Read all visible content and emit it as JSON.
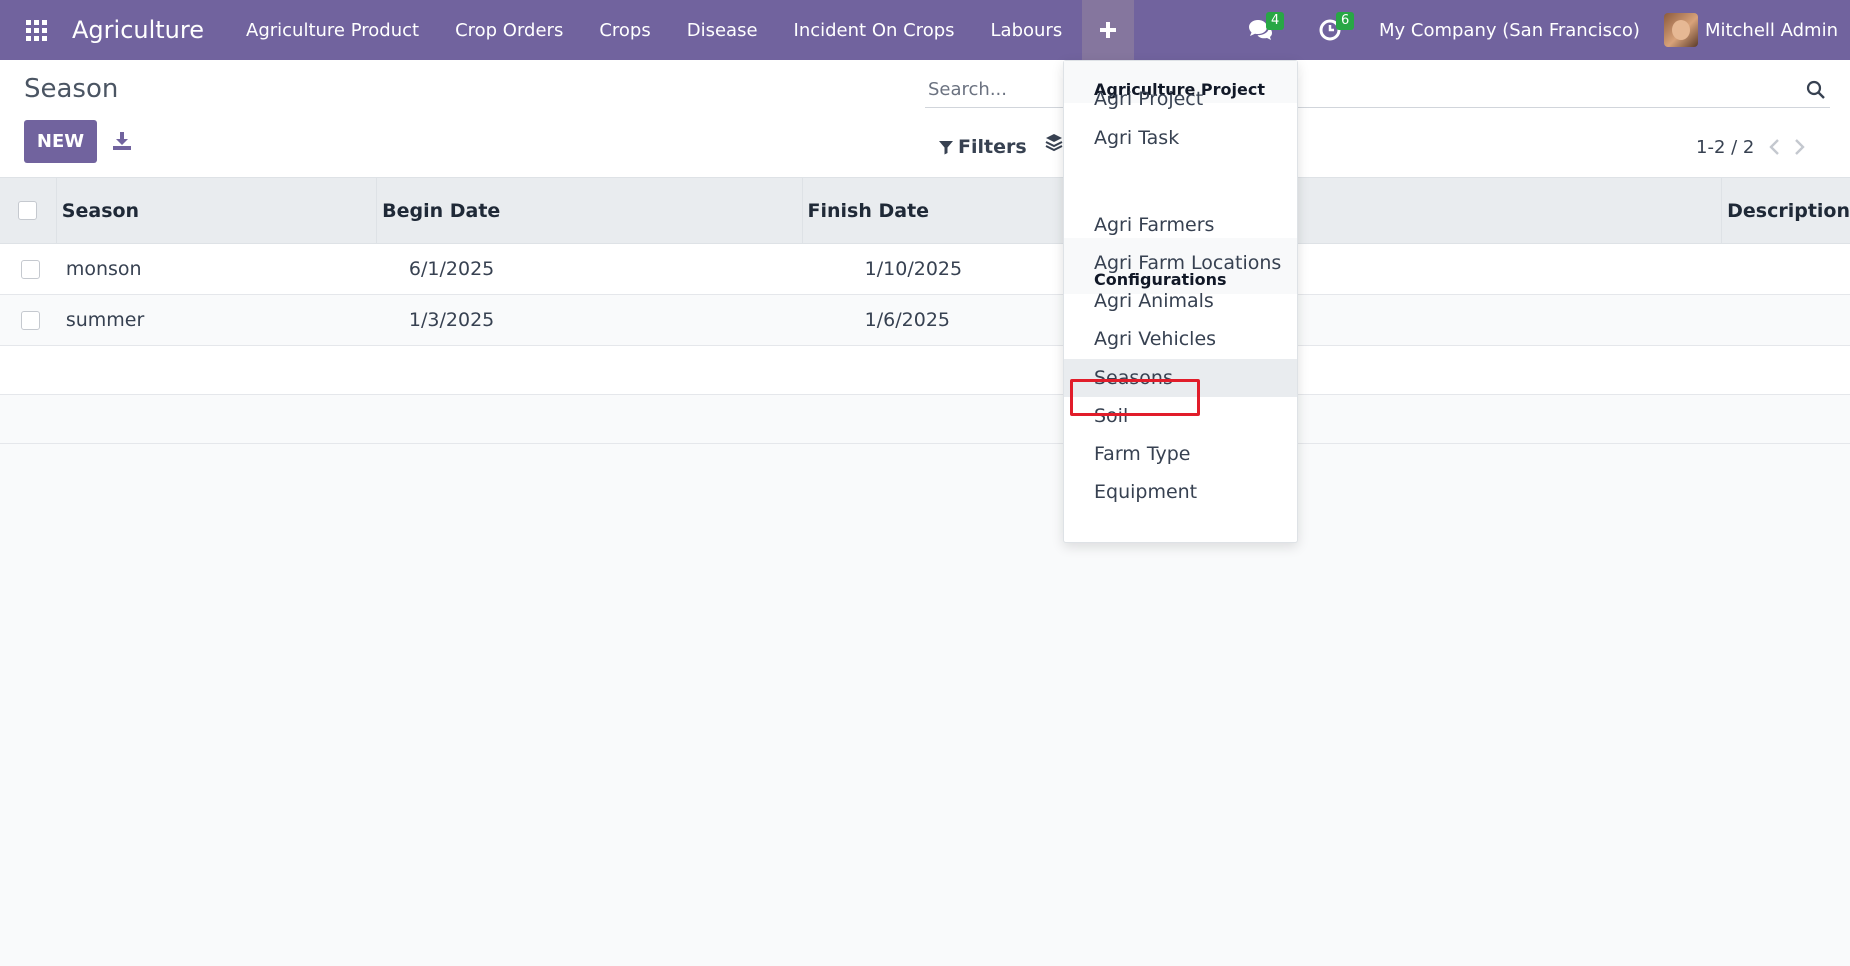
{
  "navbar": {
    "app_title": "Agriculture",
    "menu": [
      "Agriculture Product",
      "Crop Orders",
      "Crops",
      "Disease",
      "Incident On Crops",
      "Labours"
    ],
    "messages_count": "4",
    "activities_count": "6",
    "company": "My Company (San Francisco)",
    "user": "Mitchell Admin",
    "accent_color": "#71639e",
    "badge_color": "#28a745"
  },
  "control_panel": {
    "title": "Season",
    "new_label": "NEW",
    "search_placeholder": "Search...",
    "filters_label": "Filters",
    "pager": "1-2 / 2"
  },
  "table": {
    "columns": [
      "Season",
      "Begin Date",
      "Finish Date",
      "",
      "Description"
    ],
    "rows": [
      {
        "season": "monson",
        "begin": "6/1/2025",
        "finish": "1/10/2025",
        "description": ""
      },
      {
        "season": "summer",
        "begin": "1/3/2025",
        "finish": "1/6/2025",
        "description": ""
      }
    ]
  },
  "dropdown": {
    "section_project": "Agriculture Project",
    "project_items": [
      "Agri Project",
      "Agri Task"
    ],
    "section_config": "Configurations",
    "config_items": [
      "Agri Farmers",
      "Agri Farm Locations",
      "Agri Animals",
      "Agri Vehicles",
      "Seasons",
      "Soil",
      "Farm Type",
      "Equipment"
    ],
    "highlighted_item": "Seasons"
  }
}
